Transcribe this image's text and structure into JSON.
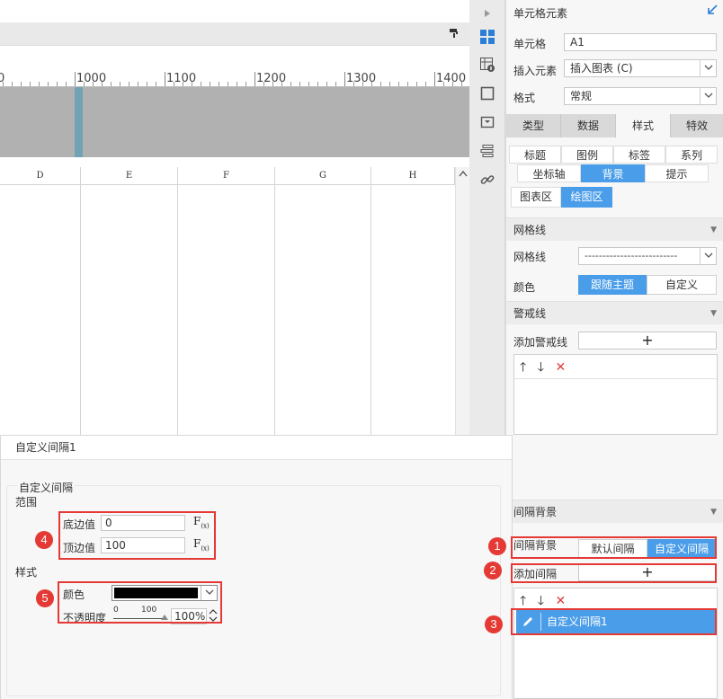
{
  "ruler": {
    "ticks": [
      "0",
      "1000",
      "1100",
      "1200",
      "1300",
      "1400"
    ]
  },
  "grid": {
    "columns": [
      "D",
      "E",
      "F",
      "G",
      "H"
    ]
  },
  "icons": {
    "toolbar": "format-painter-icon",
    "strip": [
      "expand-arrow-icon",
      "cell-element-icon",
      "cell-attribute-icon",
      "float-element-icon",
      "widget-icon",
      "template-web-icon",
      "hyperlink-icon"
    ]
  },
  "panel": {
    "title": "单元格元素",
    "cell_label": "单元格",
    "cell_value": "A1",
    "insert_label": "插入元素",
    "insert_value": "插入图表 (C)",
    "format_label": "格式",
    "format_value": "常规",
    "tabs": [
      "类型",
      "数据",
      "样式",
      "特效"
    ],
    "active_tab": "样式",
    "subtabs_row1": [
      "标题",
      "图例",
      "标签",
      "系列"
    ],
    "subtabs_row2": [
      "坐标轴",
      "背景",
      "提示"
    ],
    "subtabs_row3": [
      "图表区",
      "绘图区"
    ],
    "gridline_section": "网格线",
    "gridline_label": "网格线",
    "gridline_value": "--------------------------",
    "color_label": "颜色",
    "color_follow": "跟随主题",
    "color_custom": "自定义",
    "warning_section": "警戒线",
    "add_warning_label": "添加警戒线",
    "plus": "+",
    "up_arrow": "🡑",
    "down_arrow": "🡓",
    "delete": "✕",
    "interval_section": "间隔背景",
    "interval_bg_label": "间隔背景",
    "interval_default": "默认间隔",
    "interval_custom": "自定义间隔",
    "add_interval_label": "添加间隔",
    "interval_item": "自定义间隔1"
  },
  "dialog": {
    "title": "自定义间隔1",
    "group_title": "自定义间隔",
    "range_label": "范围",
    "bottom_label": "底边值",
    "bottom_value": "0",
    "top_label": "顶边值",
    "top_value": "100",
    "fx_text": "F",
    "fx_sub": "(x)",
    "style_label": "样式",
    "color_label": "颜色",
    "color_value": "#000000",
    "opacity_label": "不透明度",
    "slider_min": "0",
    "slider_max": "100",
    "opacity_value": "100%"
  },
  "annotations": [
    "1",
    "2",
    "3",
    "4",
    "5"
  ],
  "colors": {
    "accent": "#4a9de8",
    "annotation": "#e53935"
  }
}
